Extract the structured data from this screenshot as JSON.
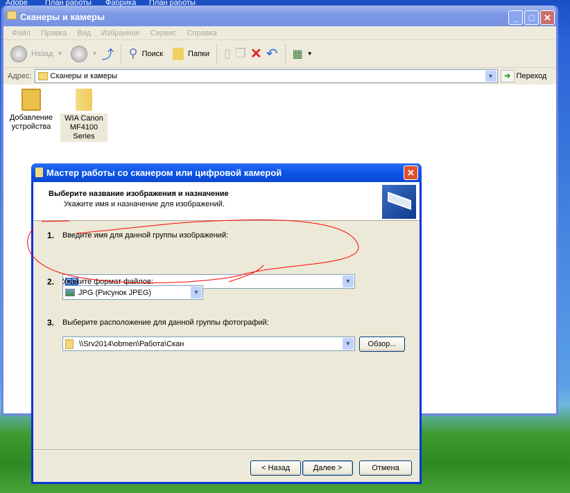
{
  "taskbar": {
    "items": [
      "Adobe",
      "План работы",
      "Фабрика",
      "План работы"
    ]
  },
  "explorer": {
    "title": "Сканеры и камеры",
    "menu": [
      "Файл",
      "Правка",
      "Вид",
      "Избранное",
      "Сервис",
      "Справка"
    ],
    "toolbar": {
      "back": "Назад",
      "search": "Поиск",
      "folders": "Папки"
    },
    "address": {
      "label": "Адрес:",
      "value": "Сканеры и камеры",
      "go": "Переход"
    },
    "items": [
      {
        "line1": "Добавление",
        "line2": "устройства"
      },
      {
        "line1": "WIA Canon",
        "line2": "MF4100 Series"
      }
    ]
  },
  "wizard": {
    "title": "Мастер работы со сканером или цифровой камерой",
    "heading": "Выберите название изображения и назначение",
    "subheading": "Укажите имя и назначение для изображений.",
    "step1": {
      "num": "1.",
      "label": "Введите имя для данной группы изображений:",
      "value": "CO"
    },
    "step2": {
      "num": "2.",
      "label": "Укажите формат файлов:",
      "value": "JPG (Рисунок JPEG)"
    },
    "step3": {
      "num": "3.",
      "label": "Выберите расположение для данной группы фотографий:",
      "value": "\\\\Srv2014\\obmen\\Работа\\Скан",
      "browse": "Обзор..."
    },
    "buttons": {
      "back": "< Назад",
      "next": "Далее >",
      "cancel": "Отмена"
    }
  },
  "annotation": {
    "color": "#ff0000"
  }
}
